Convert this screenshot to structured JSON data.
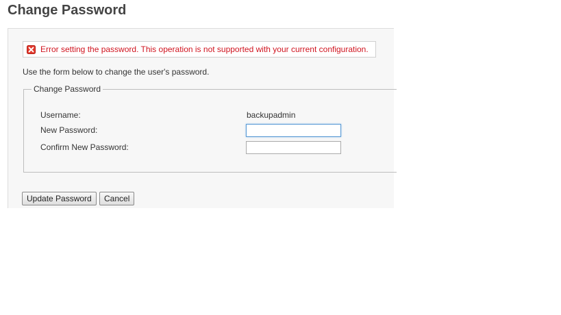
{
  "page": {
    "title": "Change Password"
  },
  "error": {
    "message": "Error setting the password. This operation is not supported with your current configuration.",
    "icon": "error-icon",
    "color": "#d0141f"
  },
  "instructions": "Use the form below to change the user's password.",
  "form": {
    "legend": "Change Password",
    "username_label": "Username:",
    "username_value": "backupadmin",
    "new_password_label": "New Password:",
    "new_password_value": "",
    "confirm_password_label": "Confirm New Password:",
    "confirm_password_value": ""
  },
  "buttons": {
    "update_label": "Update Password",
    "cancel_label": "Cancel"
  }
}
